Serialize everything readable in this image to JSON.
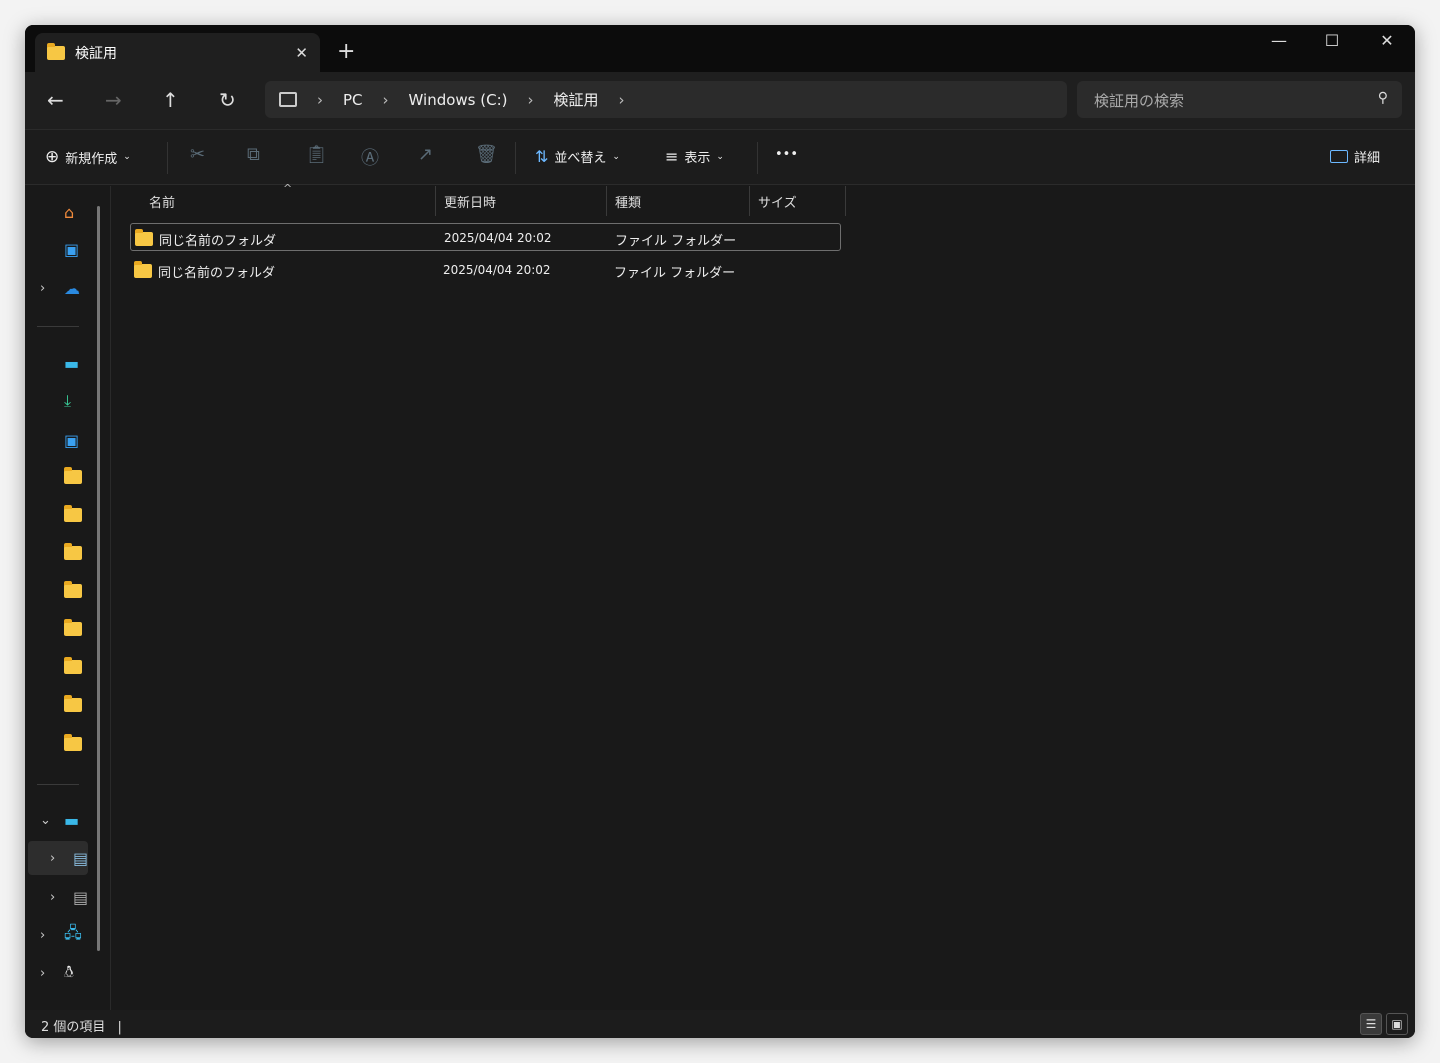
{
  "window": {
    "tab_title": "検証用",
    "new_tab": "+",
    "close_tab": "✕",
    "minimize": "—",
    "maximize": "☐",
    "close": "✕"
  },
  "nav": {
    "back": "←",
    "forward": "→",
    "up": "↑",
    "refresh": "↻",
    "breadcrumb": [
      "PC",
      "Windows (C:)",
      "検証用"
    ],
    "search_placeholder": "検証用の検索"
  },
  "toolbar": {
    "new": "新規作成",
    "sort": "並べ替え",
    "view": "表示",
    "more": "•••",
    "details": "詳細"
  },
  "columns": {
    "name": "名前",
    "modified": "更新日時",
    "type": "種類",
    "size": "サイズ"
  },
  "files": [
    {
      "name": "同じ名前のフォルダ",
      "modified": "2025/04/04 20:02",
      "type": "ファイル フォルダー",
      "size": ""
    },
    {
      "name": "同じ名前のフォルダ",
      "modified": "2025/04/04 20:02",
      "type": "ファイル フォルダー",
      "size": ""
    }
  ],
  "status": {
    "count": "2 個の項目"
  }
}
